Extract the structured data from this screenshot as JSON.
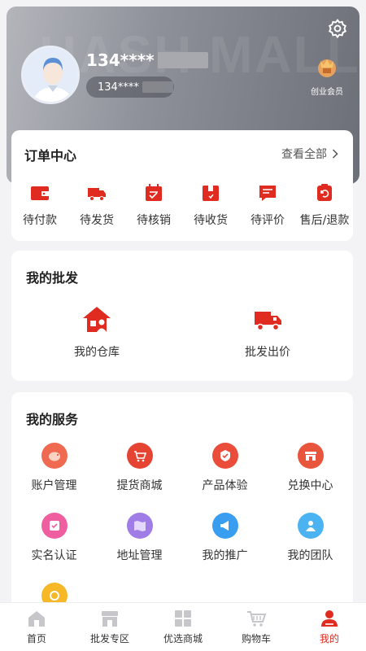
{
  "header": {
    "watermark": "HASH MALL",
    "username": "134****",
    "phone": "134****",
    "member_label": "创业会员"
  },
  "orders": {
    "title": "订单中心",
    "view_all": "查看全部",
    "items": [
      {
        "label": "待付款",
        "icon": "wallet-icon"
      },
      {
        "label": "待发货",
        "icon": "truck-icon"
      },
      {
        "label": "待核销",
        "icon": "calendar-check-icon"
      },
      {
        "label": "待收货",
        "icon": "package-icon"
      },
      {
        "label": "待评价",
        "icon": "comment-icon"
      },
      {
        "label": "售后/退款",
        "icon": "refund-icon"
      }
    ]
  },
  "wholesale": {
    "title": "我的批发",
    "items": [
      {
        "label": "我的仓库",
        "icon": "warehouse-icon"
      },
      {
        "label": "批发出价",
        "icon": "delivery-truck-icon"
      }
    ]
  },
  "services": {
    "title": "我的服务",
    "items": [
      {
        "label": "账户管理",
        "icon": "piggy-bank-icon"
      },
      {
        "label": "提货商城",
        "icon": "cart-icon"
      },
      {
        "label": "产品体验",
        "icon": "experience-icon"
      },
      {
        "label": "兑换中心",
        "icon": "store-icon"
      },
      {
        "label": "实名认证",
        "icon": "id-verify-icon"
      },
      {
        "label": "地址管理",
        "icon": "map-icon"
      },
      {
        "label": "我的推广",
        "icon": "megaphone-icon"
      },
      {
        "label": "我的团队",
        "icon": "team-icon"
      }
    ]
  },
  "tabbar": {
    "items": [
      {
        "label": "首页",
        "icon": "home-icon"
      },
      {
        "label": "批发专区",
        "icon": "shop-icon"
      },
      {
        "label": "优选商城",
        "icon": "grid-icon"
      },
      {
        "label": "购物车",
        "icon": "shopping-cart-icon"
      },
      {
        "label": "我的",
        "icon": "profile-icon",
        "active": true
      }
    ]
  },
  "colors": {
    "accent": "#e02b20",
    "header_gradient_start": "#b3b5bb",
    "header_gradient_end": "#6c6f77"
  }
}
